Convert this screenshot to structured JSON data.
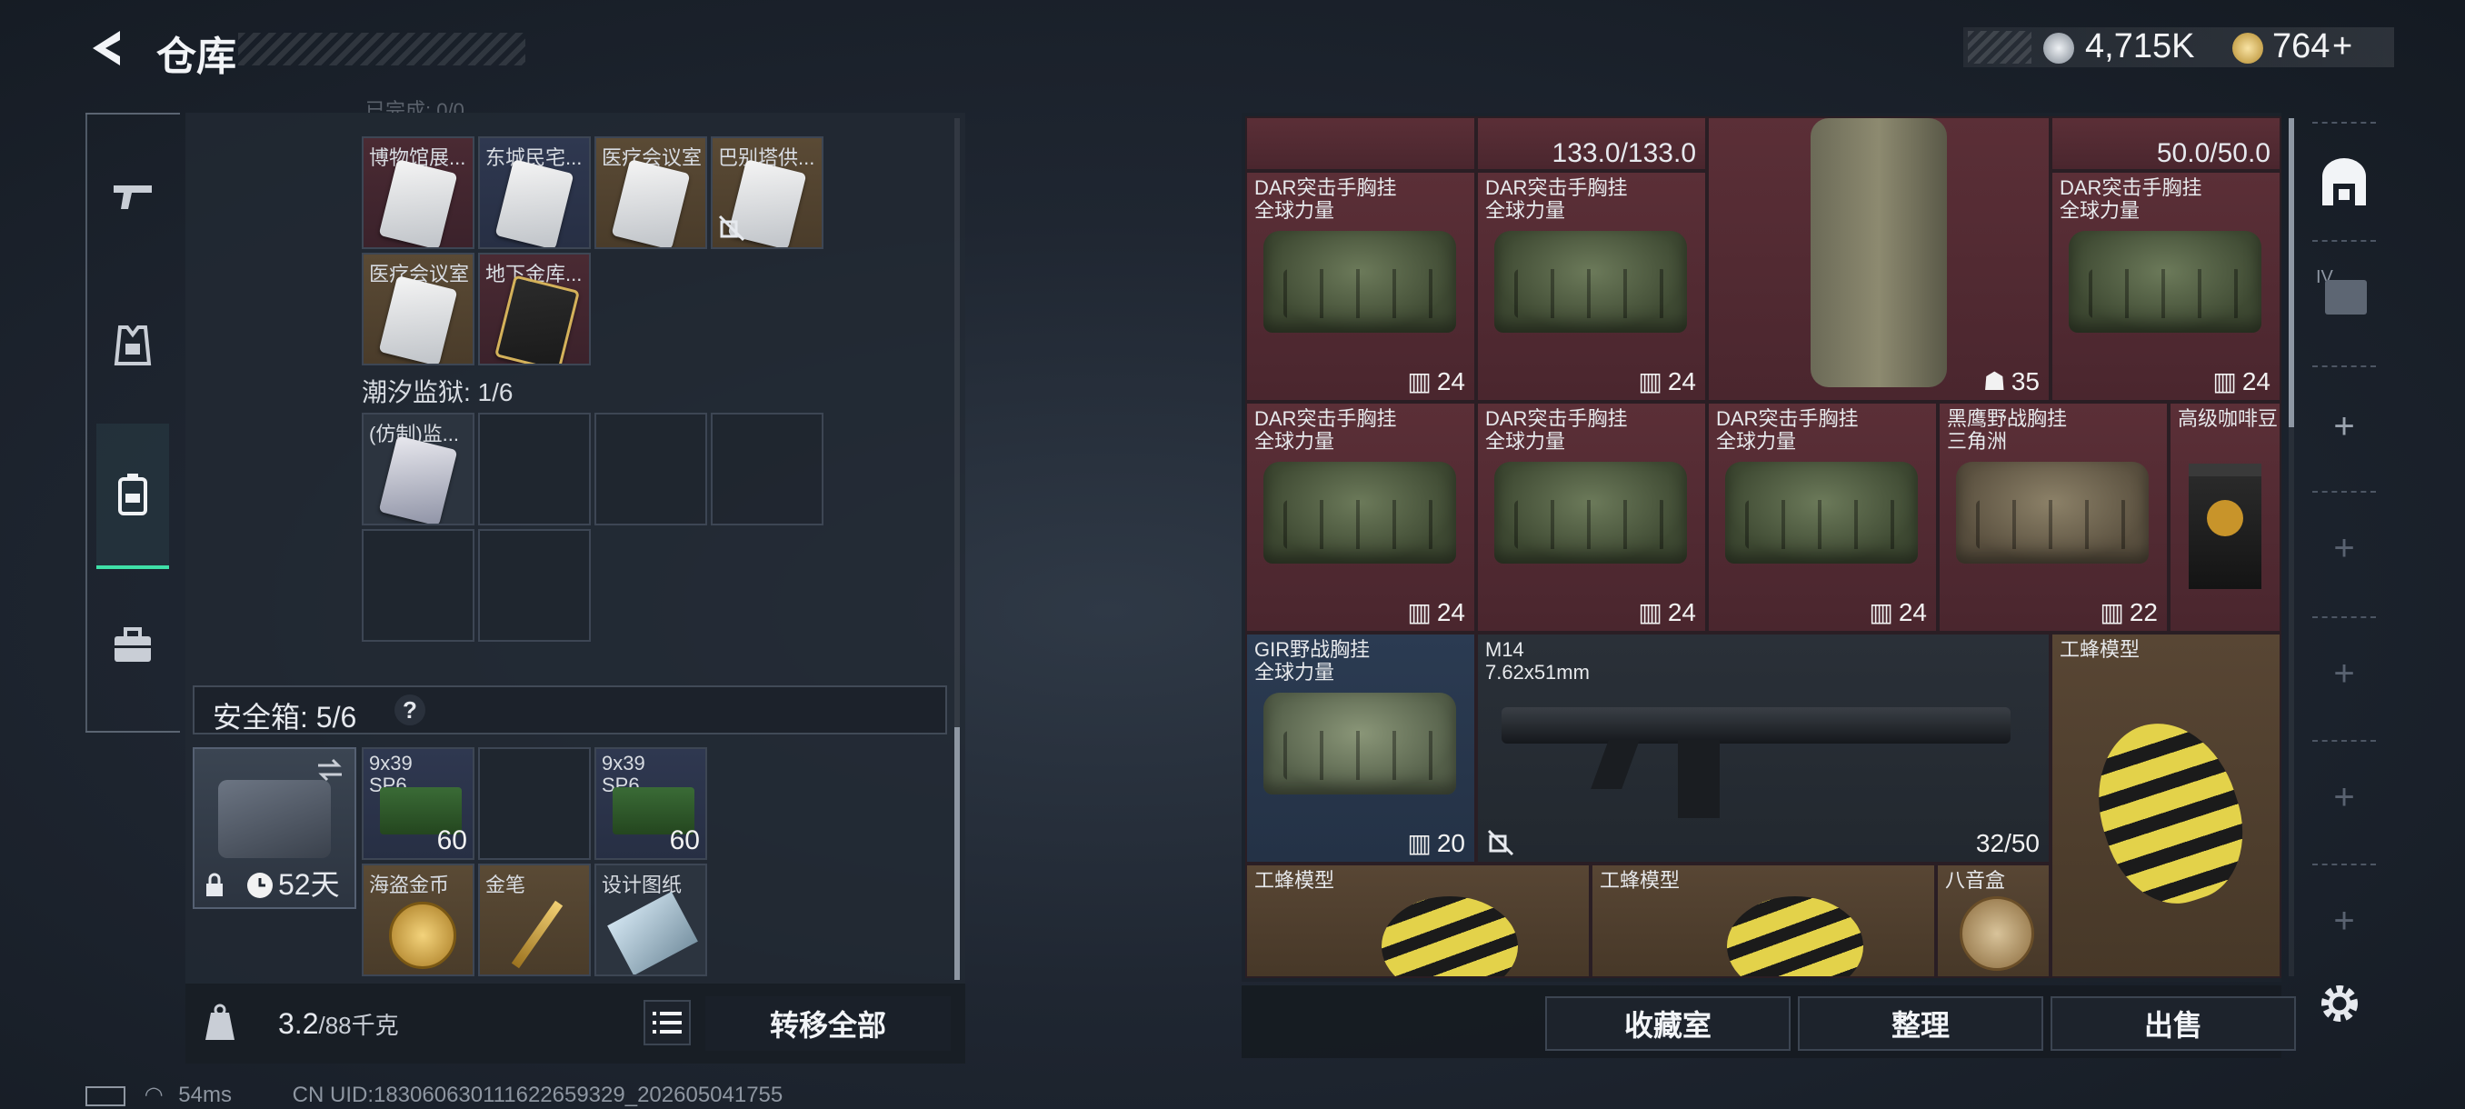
{
  "header": {
    "title": "仓库"
  },
  "currency": {
    "silver": "4,715K",
    "gold": "764",
    "gold_plus": "+"
  },
  "nav": {
    "items": [
      "weapon",
      "armor",
      "backpack",
      "case"
    ]
  },
  "stash": {
    "top_partial": "已完成: 0/0",
    "row1": [
      "博物馆展...",
      "东城民宅...",
      "医疗会议室",
      "巴别塔供..."
    ],
    "row2": [
      "医疗会议室",
      "地下金库..."
    ],
    "tide_prison": "潮汐监狱: 1/6",
    "tide_item": "(仿制)监..."
  },
  "safe": {
    "title": "安全箱: 5/6",
    "help": "?",
    "days": "52天",
    "items": [
      {
        "label": "9x39\nSP6",
        "qty": "60"
      },
      {
        "label": "9x39\nSP6",
        "qty": "60"
      },
      {
        "label": "海盗金币",
        "qty": ""
      },
      {
        "label": "金笔",
        "qty": ""
      },
      {
        "label": "设计图纸",
        "qty": ""
      }
    ]
  },
  "weight": {
    "current": "3.2",
    "max": "/88千克"
  },
  "transfer_all": "转移全部",
  "inventory": {
    "durability_left": "133.0/133.0",
    "durability_right": "50.0/50.0",
    "r1": [
      {
        "name": "DAR突击手胸挂\n全球力量",
        "count": "24"
      },
      {
        "name": "DAR突击手胸挂\n全球力量",
        "count": "24"
      },
      {
        "name": "",
        "count": "35"
      },
      {
        "name": "DAR突击手胸挂\n全球力量",
        "count": "24"
      }
    ],
    "r2": [
      {
        "name": "DAR突击手胸挂\n全球力量",
        "count": "24"
      },
      {
        "name": "DAR突击手胸挂\n全球力量",
        "count": "24"
      },
      {
        "name": "DAR突击手胸挂\n全球力量",
        "count": "24"
      },
      {
        "name": "黑鹰野战胸挂\n三角洲",
        "count": "22"
      },
      {
        "name": "高级咖啡豆",
        "count": ""
      }
    ],
    "r3": [
      {
        "name": "GIR野战胸挂\n全球力量",
        "count": "20"
      },
      {
        "name": "M14\n7.62x51mm",
        "count": "32/50"
      },
      {
        "name": "工蜂模型",
        "count": ""
      }
    ],
    "r4": [
      {
        "name": "工蜂模型"
      },
      {
        "name": "工蜂模型"
      },
      {
        "name": "八音盒"
      }
    ]
  },
  "actions": {
    "collection": "收藏室",
    "sort": "整理",
    "sell": "出售"
  },
  "status": {
    "ping": "54ms",
    "uid": "CN UID:183060630111622659329_202605041755"
  },
  "sidebar_tabs": [
    "IV"
  ]
}
